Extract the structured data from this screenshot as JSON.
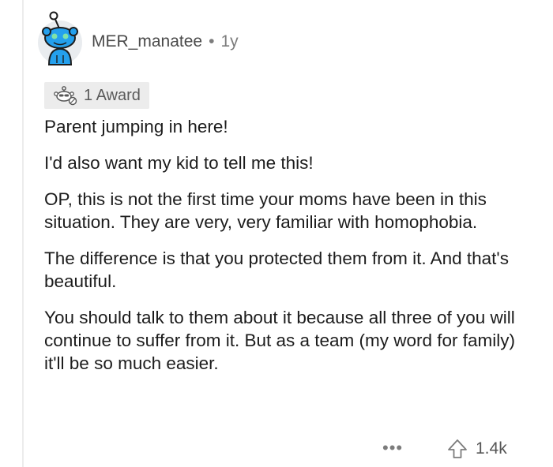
{
  "comment": {
    "username": "MER_manatee",
    "separator": "•",
    "age": "1y",
    "award_label": "1 Award",
    "paragraphs": [
      "Parent jumping in here!",
      "I'd also want my kid to tell me this!",
      "OP, this is not the first time your moms have been in this situation. They are very, very familiar with homophobia.",
      "The difference is that you protected them from it. And that's beautiful.",
      "You should talk to them about it because all three of you will continue to suffer from it. But as a team (my word for family) it'll be so much easier."
    ],
    "more_label": "•••",
    "vote_count": "1.4k"
  },
  "colors": {
    "avatar_bg": "#e9ecef",
    "avatar_snoo": "#24a0ed",
    "text": "#1c1c1c",
    "meta": "#7c7c7c",
    "award_bg": "#ececec"
  },
  "icons": {
    "avatar": "snoo-avatar-icon",
    "award": "award-icon",
    "upvote": "upvote-arrow-icon",
    "more": "more-options-icon"
  }
}
